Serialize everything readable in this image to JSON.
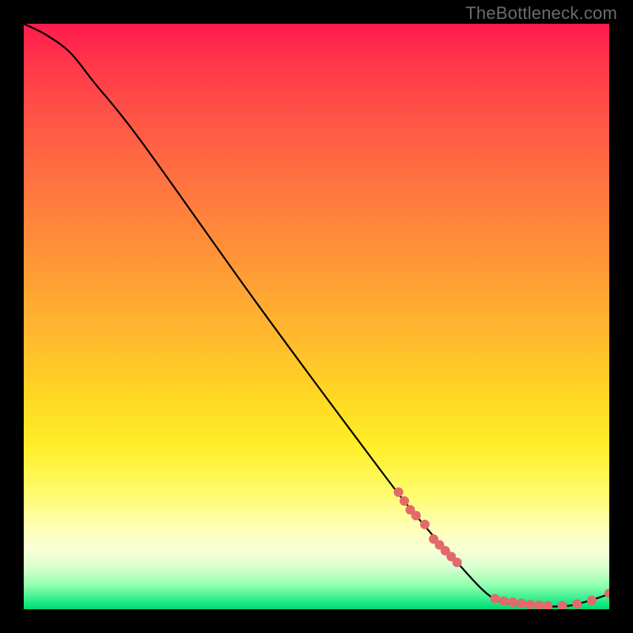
{
  "watermark": "TheBottleneck.com",
  "chart_data": {
    "type": "line",
    "title": "",
    "xlabel": "",
    "ylabel": "",
    "xlim": [
      0,
      100
    ],
    "ylim": [
      0,
      100
    ],
    "curve": {
      "name": "bottleneck-curve",
      "color": "#000000",
      "points": [
        {
          "x": 0,
          "y": 100
        },
        {
          "x": 4,
          "y": 98
        },
        {
          "x": 8,
          "y": 95
        },
        {
          "x": 12,
          "y": 90
        },
        {
          "x": 20,
          "y": 80
        },
        {
          "x": 40,
          "y": 52
        },
        {
          "x": 60,
          "y": 25
        },
        {
          "x": 67,
          "y": 16
        },
        {
          "x": 74,
          "y": 8
        },
        {
          "x": 80,
          "y": 2
        },
        {
          "x": 85,
          "y": 0.8
        },
        {
          "x": 92,
          "y": 0.5
        },
        {
          "x": 96,
          "y": 1.3
        },
        {
          "x": 100,
          "y": 2.6
        }
      ]
    },
    "markers": {
      "name": "gpu-points",
      "color": "#e26a6a",
      "radius": 6,
      "points": [
        {
          "x": 64,
          "y": 20
        },
        {
          "x": 65,
          "y": 18.5
        },
        {
          "x": 66,
          "y": 17
        },
        {
          "x": 67,
          "y": 16
        },
        {
          "x": 68.5,
          "y": 14.5
        },
        {
          "x": 70,
          "y": 12
        },
        {
          "x": 71,
          "y": 11
        },
        {
          "x": 72,
          "y": 10
        },
        {
          "x": 73,
          "y": 9
        },
        {
          "x": 74,
          "y": 8
        },
        {
          "x": 80.5,
          "y": 1.8
        },
        {
          "x": 82,
          "y": 1.4
        },
        {
          "x": 83.5,
          "y": 1.2
        },
        {
          "x": 85,
          "y": 1.0
        },
        {
          "x": 86.5,
          "y": 0.8
        },
        {
          "x": 88,
          "y": 0.7
        },
        {
          "x": 89.5,
          "y": 0.6
        },
        {
          "x": 92,
          "y": 0.6
        },
        {
          "x": 94.5,
          "y": 0.9
        },
        {
          "x": 97,
          "y": 1.5
        },
        {
          "x": 100,
          "y": 2.7
        }
      ]
    },
    "gradient_stops": [
      {
        "pos": 0.0,
        "color": "#ff1a4d"
      },
      {
        "pos": 0.4,
        "color": "#ff9a36"
      },
      {
        "pos": 0.72,
        "color": "#ffee28"
      },
      {
        "pos": 0.9,
        "color": "#f7ffd6"
      },
      {
        "pos": 1.0,
        "color": "#00d86f"
      }
    ]
  }
}
